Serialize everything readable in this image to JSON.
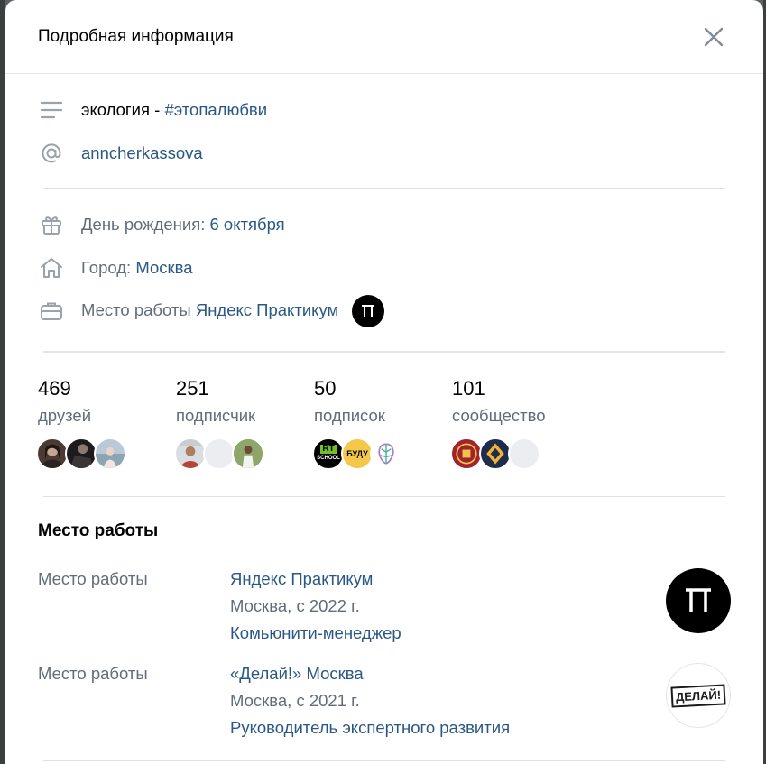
{
  "modal": {
    "title": "Подробная информация"
  },
  "about": {
    "status_text": "экология - ",
    "status_hashtag": "#этопалюбви",
    "nickname": "anncherkassova"
  },
  "details": {
    "birthday_label": "День рождения: ",
    "birthday_value": "6 октября",
    "city_label": "Город: ",
    "city_value": "Москва",
    "work_label": "Место работы ",
    "work_value": "Яндекс Практикум"
  },
  "stats": [
    {
      "count": "469",
      "label": "друзей"
    },
    {
      "count": "251",
      "label": "подписчик"
    },
    {
      "count": "50",
      "label": "подписок"
    },
    {
      "count": "101",
      "label": "сообщество"
    }
  ],
  "subscription_avatar_texts": {
    "rt_school_top": "RT",
    "rt_school_bottom": "SCHOOL",
    "budu": "БУДУ"
  },
  "work_section": {
    "title": "Место работы",
    "jobs": [
      {
        "label": "Место работы",
        "company": "Яндекс Практикум",
        "city_years": "Москва, с 2022 г.",
        "position": "Комьюнити-менеджер"
      },
      {
        "label": "Место работы",
        "company": "«Делай!» Москва",
        "city_years": "Москва, с 2021 г.",
        "position": "Руководитель экспертного развития",
        "logo_text": "ДЕЛАЙ!"
      }
    ]
  },
  "colors": {
    "link": "#2a5885",
    "muted": "#626d7a",
    "icon": "#99a2ad"
  }
}
